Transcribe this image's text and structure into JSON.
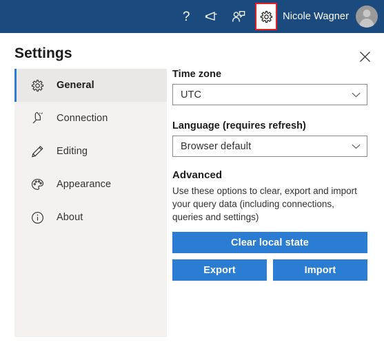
{
  "topbar": {
    "icons": [
      {
        "name": "help-icon",
        "glyph": "?"
      },
      {
        "name": "announcements-icon",
        "glyph": "megaphone"
      },
      {
        "name": "feedback-icon",
        "glyph": "person-chat"
      },
      {
        "name": "settings-gear-icon",
        "glyph": "gear"
      }
    ],
    "user_name": "Nicole Wagner",
    "avatar_label": "user-avatar",
    "background_color": "#1a4a7e",
    "highlight_color": "#e02020"
  },
  "panel": {
    "title": "Settings",
    "close_label": "×"
  },
  "sidebar": {
    "items": [
      {
        "label": "General",
        "icon": "gear-icon",
        "selected": true
      },
      {
        "label": "Connection",
        "icon": "plug-icon",
        "selected": false
      },
      {
        "label": "Editing",
        "icon": "pencil-icon",
        "selected": false
      },
      {
        "label": "Appearance",
        "icon": "palette-icon",
        "selected": false
      },
      {
        "label": "About",
        "icon": "info-icon",
        "selected": false
      }
    ],
    "accent_color": "#2b7cd3",
    "background_color": "#f3f2f1"
  },
  "main": {
    "timezone": {
      "label": "Time zone",
      "value": "UTC"
    },
    "language": {
      "label": "Language (requires refresh)",
      "value": "Browser default"
    },
    "advanced": {
      "heading": "Advanced",
      "description": "Use these options to clear, export and import your query data (including connections, queries and settings)",
      "clear_label": "Clear local state",
      "export_label": "Export",
      "import_label": "Import",
      "button_color": "#2b7cd3"
    }
  }
}
